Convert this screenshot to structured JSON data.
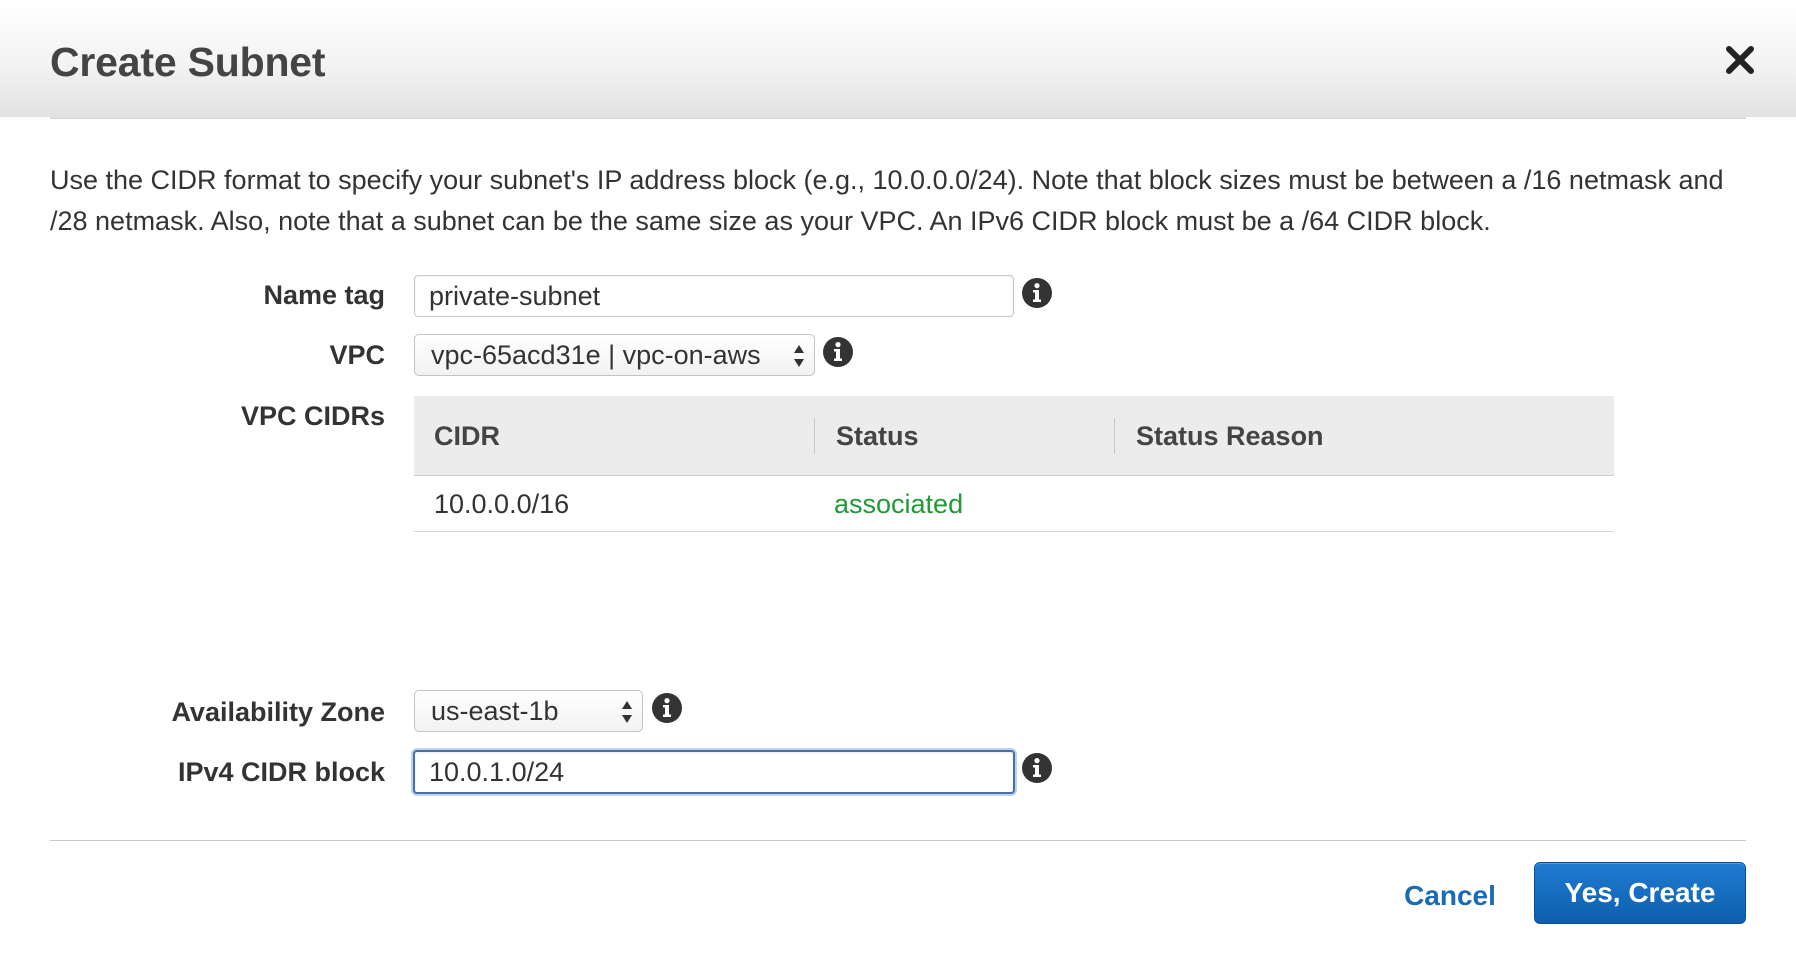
{
  "dialog": {
    "title": "Create Subnet",
    "description": "Use the CIDR format to specify your subnet's IP address block (e.g., 10.0.0.0/24). Note that block sizes must be between a /16 netmask and /28 netmask. Also, note that a subnet can be the same size as your VPC. An IPv6 CIDR block must be a /64 CIDR block."
  },
  "form": {
    "name_tag": {
      "label": "Name tag",
      "value": "private-subnet"
    },
    "vpc": {
      "label": "VPC",
      "selected": "vpc-65acd31e | vpc-on-aws"
    },
    "vpc_cidrs": {
      "label": "VPC CIDRs",
      "columns": [
        "CIDR",
        "Status",
        "Status Reason"
      ],
      "rows": [
        {
          "cidr": "10.0.0.0/16",
          "status": "associated",
          "status_reason": ""
        }
      ]
    },
    "availability_zone": {
      "label": "Availability Zone",
      "selected": "us-east-1b"
    },
    "ipv4_cidr_block": {
      "label": "IPv4 CIDR block",
      "value": "10.0.1.0/24"
    }
  },
  "footer": {
    "cancel_label": "Cancel",
    "create_label": "Yes, Create"
  },
  "icons": {
    "close": "close-icon",
    "info": "info-icon",
    "select_arrows": "select-arrows-icon"
  },
  "colors": {
    "primary_button": "#1466bd",
    "link": "#1a6bb5",
    "status_associated": "#1f9a35",
    "focus_ring": "#4a6fa8"
  }
}
